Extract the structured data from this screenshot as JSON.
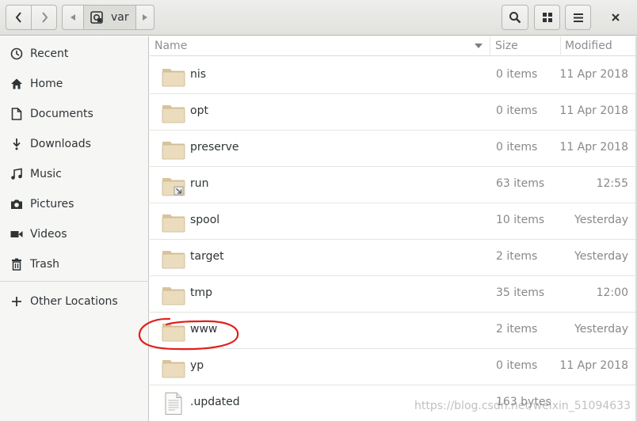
{
  "header": {
    "path": [
      "var"
    ]
  },
  "sidebar": {
    "items": [
      {
        "label": "Recent",
        "icon": "clock-icon"
      },
      {
        "label": "Home",
        "icon": "home-icon"
      },
      {
        "label": "Documents",
        "icon": "document-icon"
      },
      {
        "label": "Downloads",
        "icon": "download-icon"
      },
      {
        "label": "Music",
        "icon": "music-icon"
      },
      {
        "label": "Pictures",
        "icon": "camera-icon"
      },
      {
        "label": "Videos",
        "icon": "video-icon"
      },
      {
        "label": "Trash",
        "icon": "trash-icon"
      }
    ],
    "other": {
      "label": "Other Locations",
      "icon": "plus-icon"
    }
  },
  "columns": {
    "name": "Name",
    "size": "Size",
    "modified": "Modified"
  },
  "files": [
    {
      "name": "nis",
      "size": "0 items",
      "modified": "11 Apr 2018",
      "type": "folder"
    },
    {
      "name": "opt",
      "size": "0 items",
      "modified": "11 Apr 2018",
      "type": "folder"
    },
    {
      "name": "preserve",
      "size": "0 items",
      "modified": "11 Apr 2018",
      "type": "folder"
    },
    {
      "name": "run",
      "size": "63 items",
      "modified": "12:55",
      "type": "folder-link"
    },
    {
      "name": "spool",
      "size": "10 items",
      "modified": "Yesterday",
      "type": "folder"
    },
    {
      "name": "target",
      "size": "2 items",
      "modified": "Yesterday",
      "type": "folder"
    },
    {
      "name": "tmp",
      "size": "35 items",
      "modified": "12:00",
      "type": "folder"
    },
    {
      "name": "www",
      "size": "2 items",
      "modified": "Yesterday",
      "type": "folder"
    },
    {
      "name": "yp",
      "size": "0 items",
      "modified": "11 Apr 2018",
      "type": "folder"
    },
    {
      "name": ".updated",
      "size": "163 bytes",
      "modified": "",
      "type": "file"
    }
  ],
  "watermark": "https://blog.csdn.net/weixin_51094633",
  "colors": {
    "annotation": "#e0201a",
    "folder": "#e3d3b0"
  }
}
